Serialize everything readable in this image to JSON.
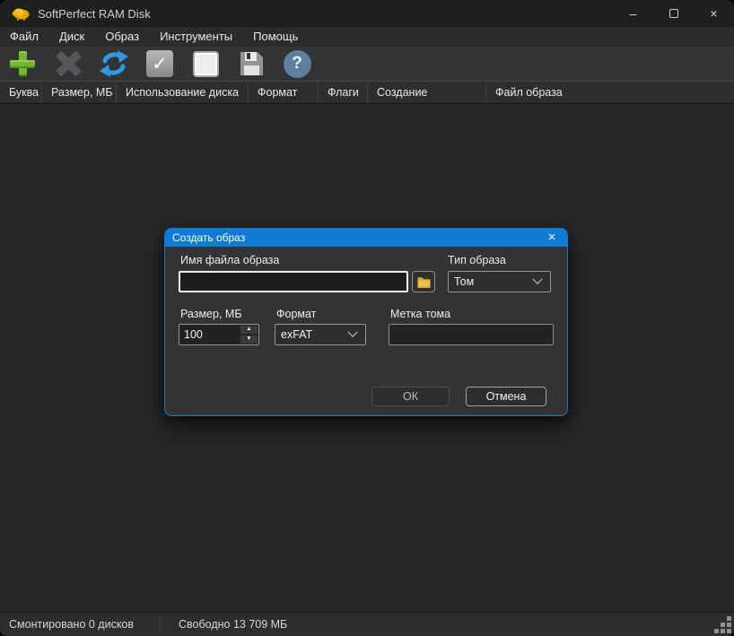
{
  "window": {
    "title": "SoftPerfect RAM Disk"
  },
  "titlebar": {
    "minimize_glyph": "–",
    "close_glyph": "×"
  },
  "menu": {
    "items": [
      "Файл",
      "Диск",
      "Образ",
      "Инструменты",
      "Помощь"
    ]
  },
  "toolbar": {
    "buttons": [
      {
        "name": "add-disk",
        "icon": "green-plus"
      },
      {
        "name": "remove-disk",
        "icon": "gray-x"
      },
      {
        "name": "refresh-remount",
        "icon": "blue-cycle-arrows"
      },
      {
        "name": "mount",
        "icon": "gray-square-check"
      },
      {
        "name": "unmount",
        "icon": "white-square"
      },
      {
        "name": "save-image",
        "icon": "floppy-disk"
      },
      {
        "name": "help",
        "icon": "blue-question-circle"
      }
    ],
    "check_glyph": "✓",
    "help_glyph": "?"
  },
  "table": {
    "columns": [
      {
        "label": "Буква"
      },
      {
        "label": "Размер, МБ"
      },
      {
        "label": "Использование диска"
      },
      {
        "label": "Формат"
      },
      {
        "label": "Флаги"
      },
      {
        "label": "Создание"
      },
      {
        "label": "Файл образа"
      }
    ],
    "rows": []
  },
  "statusbar": {
    "mounted": "Смонтировано 0 дисков",
    "free": "Свободно 13 709 МБ"
  },
  "dialog": {
    "title": "Создать образ",
    "close_glyph": "×",
    "filename": {
      "label": "Имя файла образа",
      "value": "",
      "placeholder": ""
    },
    "type": {
      "label": "Тип образа",
      "value": "Том"
    },
    "size": {
      "label": "Размер, МБ",
      "value": "100"
    },
    "format": {
      "label": "Формат",
      "value": "exFAT"
    },
    "volume": {
      "label": "Метка тома",
      "value": "",
      "placeholder": ""
    },
    "spinner": {
      "up": "▲",
      "down": "▼"
    },
    "buttons": {
      "ok": "ОК",
      "cancel": "Отмена"
    }
  },
  "colors": {
    "dialog_accent": "#0f7bd7",
    "toolbar_green": "#72b92d",
    "refresh_blue": "#2d9ae3",
    "folder_yellow": "#e9b83e"
  }
}
